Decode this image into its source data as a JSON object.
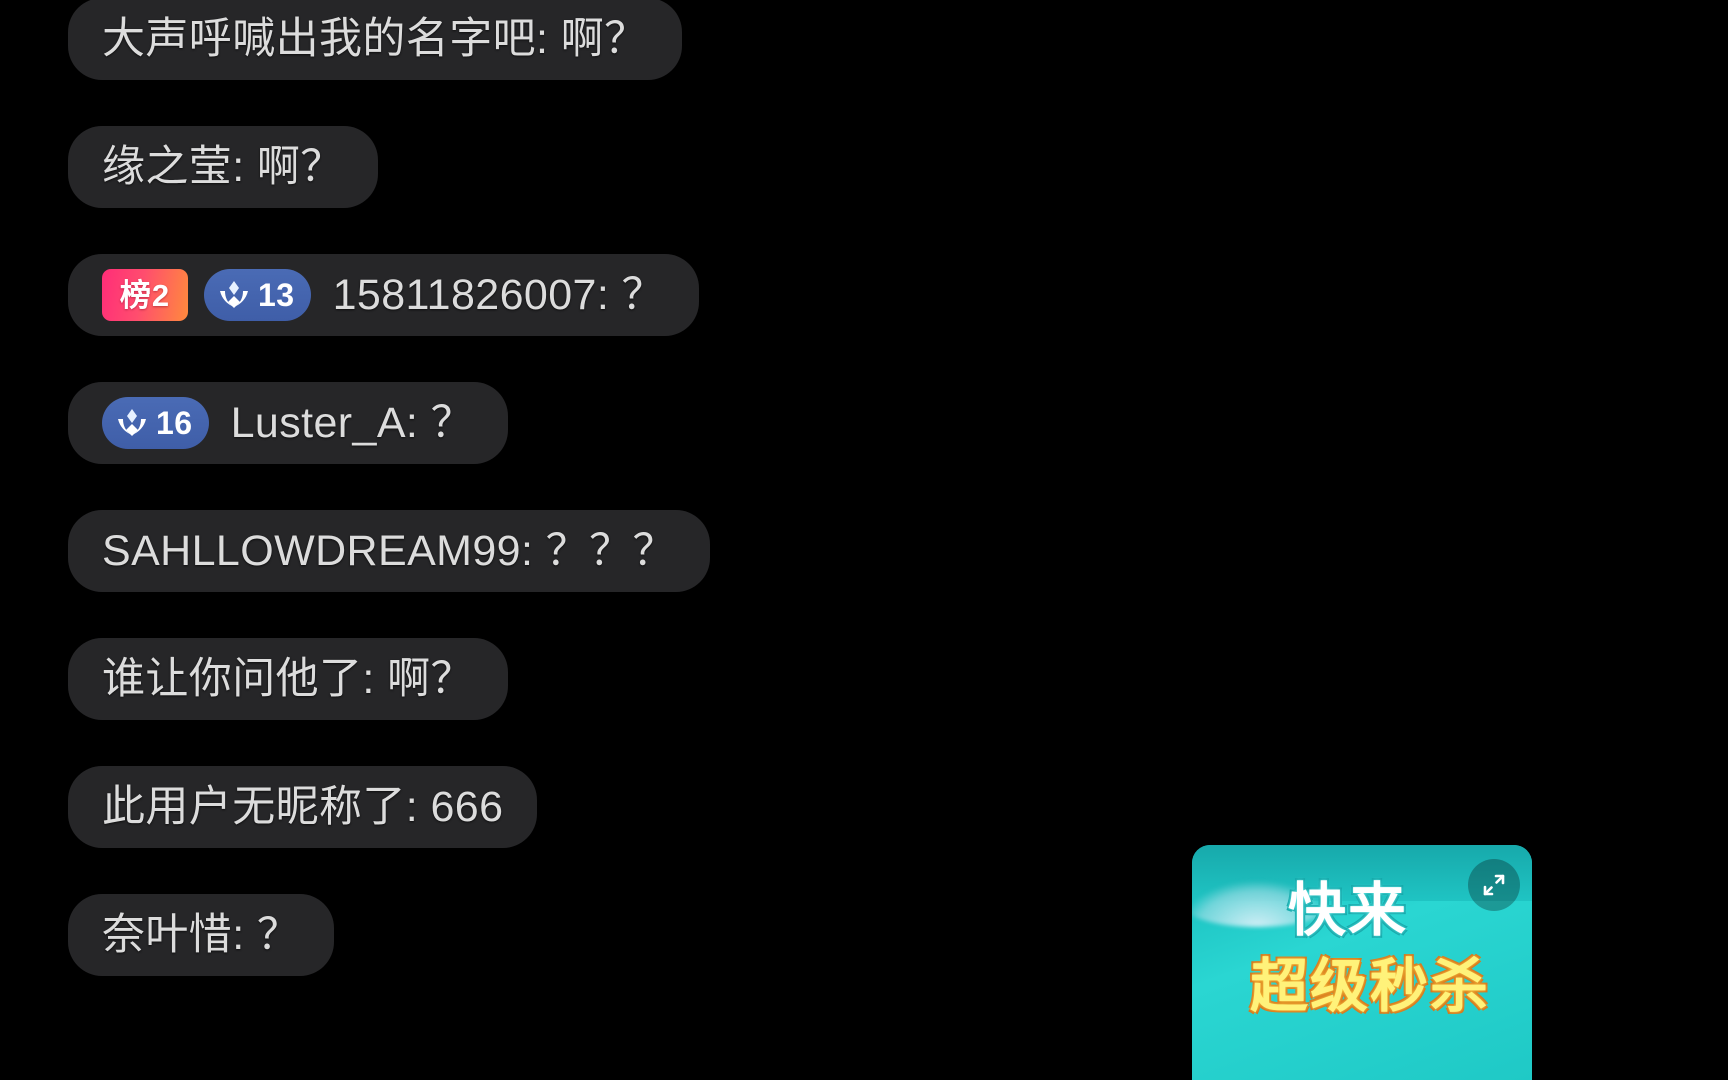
{
  "screen": {
    "background_color": "#000000",
    "app_context": "live-stream-chat-overlay"
  },
  "chat": {
    "bubble_color": "#2c2c2e",
    "text_color": "#dcdcdc",
    "messages": [
      {
        "id": "msg-1",
        "badges": [],
        "text": "大声呼喊出我的名字吧: 啊？"
      },
      {
        "id": "msg-2",
        "badges": [],
        "text": "缘之莹: 啊？"
      },
      {
        "id": "msg-3",
        "badges": [
          {
            "type": "rank",
            "label": "榜2",
            "color_start": "#ff2d78",
            "color_end": "#ff8a3d"
          },
          {
            "type": "fan-level",
            "level": "13",
            "color": "#4a6bb5"
          }
        ],
        "text": "15811826007: ？"
      },
      {
        "id": "msg-4",
        "badges": [
          {
            "type": "fan-level",
            "level": "16",
            "color": "#4a6bb5"
          }
        ],
        "text": "Luster_A: ？"
      },
      {
        "id": "msg-5",
        "badges": [],
        "text": "SAHLLOWDREAM99: ？？？"
      },
      {
        "id": "msg-6",
        "badges": [],
        "text": "谁让你问他了: 啊？"
      },
      {
        "id": "msg-7",
        "badges": [],
        "text": "此用户无昵称了: 666"
      },
      {
        "id": "msg-8",
        "badges": [],
        "text": "奈叶惜: ？"
      }
    ]
  },
  "promo_widget": {
    "icon": "expand-fullscreen-icon",
    "accent_color": "#2ad6d2",
    "line1": "快来",
    "line2": "超级秒杀",
    "expand_label": ""
  }
}
